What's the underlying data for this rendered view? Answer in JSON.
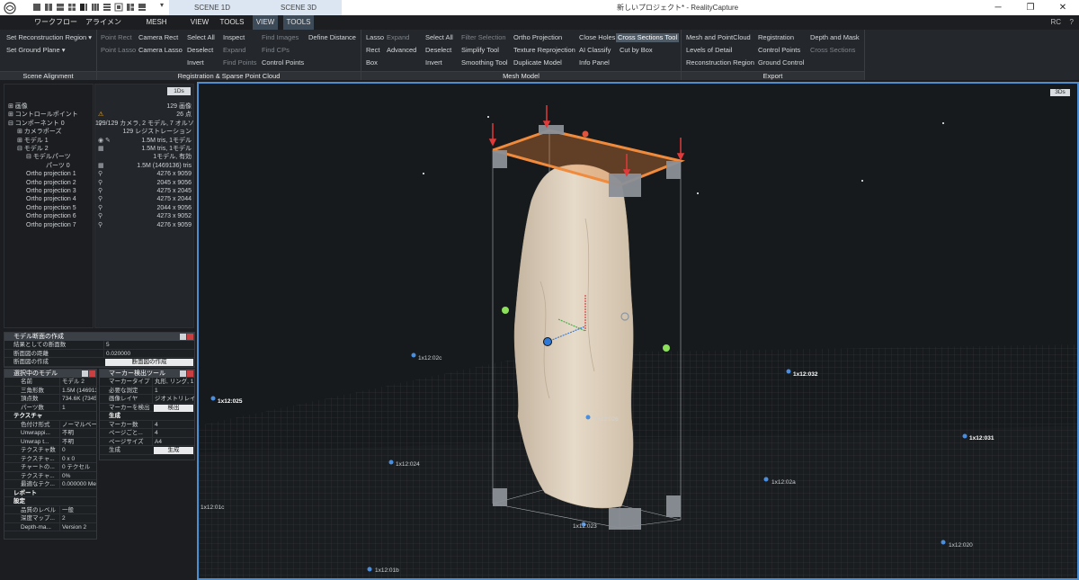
{
  "titlebar": {
    "scenes": [
      "SCENE 1D",
      "SCENE 3D"
    ],
    "window_title": "新しいプロジェクト* - RealityCapture",
    "controls": [
      "─",
      "❐",
      "✕"
    ]
  },
  "menubar": {
    "items": [
      "ワークフロー",
      "アライメント",
      "MESH MODEL",
      "VIEW",
      "TOOLS",
      "VIEW",
      "TOOLS"
    ],
    "user": "RC",
    "help": "?"
  },
  "ribbon": {
    "scene_alignment": {
      "label": "Scene Alignment",
      "buttons": [
        "Set Reconstruction Region ▾",
        "Set Ground Plane ▾"
      ]
    },
    "registration": {
      "label": "Registration & Sparse Point Cloud",
      "buttons": [
        "Point Rect",
        "Camera Rect",
        "Select All",
        "Inspect",
        "Find Images",
        "Define Distance",
        "Point Lasso",
        "Camera Lasso",
        "Deselect",
        "Expand",
        "Find CPs",
        "Invert",
        "Find Points",
        "Control Points"
      ]
    },
    "mesh_model": {
      "label": "Mesh Model",
      "buttons": [
        "Lasso",
        "Expand",
        "Select All",
        "Filter Selection",
        "Ortho Projection",
        "Close Holes",
        "Cross Sections Tool",
        "Rect",
        "Advanced",
        "Deselect",
        "Simplify Tool",
        "Texture Reprojection",
        "AI Classify",
        "Cut by Box",
        "Box",
        "Invert",
        "Smoothing Tool",
        "Duplicate Model",
        "Info Panel"
      ]
    },
    "export": {
      "label": "Export",
      "buttons": [
        "Mesh and PointCloud",
        "Registration",
        "Depth and Mask",
        "Levels of Detail",
        "Control Points",
        "Cross Sections",
        "Reconstruction Region",
        "Ground Control"
      ]
    }
  },
  "tree": {
    "tab": "1Ds",
    "items": [
      {
        "label": "⊞ 画像",
        "info": "129 画像",
        "icon": ""
      },
      {
        "label": "⊞ コントロールポイント",
        "info": "26 点",
        "icon": "⚠"
      },
      {
        "label": "⊟ コンポーネント 0",
        "info": "129/129 カメラ, 2 モデル, 7 オルソ",
        "icon": "⚲"
      },
      {
        "label": "⊞ カメラポーズ",
        "info": "129 レジストレーション",
        "icon": ""
      },
      {
        "label": "⊞ モデル 1",
        "info": "1.5M tris, 1モデル",
        "icon": "◉ ✎"
      },
      {
        "label": "⊟ モデル 2",
        "info": "1.5M tris, 1モデル",
        "icon": "▦"
      },
      {
        "label": "⊟ モデルパーツ",
        "info": "1モデル, 有効",
        "icon": ""
      },
      {
        "label": "パーツ 0",
        "info": "1.5M (1469136) tris",
        "icon": "▦"
      },
      {
        "label": "Ortho projection 1",
        "info": "4276 x 9059",
        "icon": "⚲"
      },
      {
        "label": "Ortho projection 2",
        "info": "2045 x 9056",
        "icon": "⚲"
      },
      {
        "label": "Ortho projection 3",
        "info": "4275 x 2045",
        "icon": "⚲"
      },
      {
        "label": "Ortho projection 4",
        "info": "4275 x 2044",
        "icon": "⚲"
      },
      {
        "label": "Ortho projection 5",
        "info": "2044 x 9056",
        "icon": "⚲"
      },
      {
        "label": "Ortho projection 6",
        "info": "4273 x 9052",
        "icon": "⚲"
      },
      {
        "label": "Ortho projection 7",
        "info": "4276 x 9059",
        "icon": "⚲"
      }
    ]
  },
  "cross_section_panel": {
    "title": "モデル断面の作成",
    "rows": [
      {
        "k": "結果としての断面数",
        "v": "5"
      },
      {
        "k": "断面図の距離",
        "v": "0.020000"
      },
      {
        "k": "断面図の作成",
        "v": ""
      }
    ],
    "button": "断面図の作成"
  },
  "selected_model_panel": {
    "title": "選択中のモデル",
    "rows": [
      {
        "k": "名前",
        "v": "モデル 2"
      },
      {
        "k": "三角形数",
        "v": "1.5M (1469136)"
      },
      {
        "k": "頂点数",
        "v": "734.6K (734570)"
      },
      {
        "k": "パーツ数",
        "v": "1"
      },
      {
        "k": "テクスチャ",
        "v": "",
        "sec": true
      },
      {
        "k": "色付け形式",
        "v": "ノーマルベース"
      },
      {
        "k": "Unwrappi...",
        "v": "不明"
      },
      {
        "k": "Unwrap t...",
        "v": "不明"
      },
      {
        "k": "テクスチャ数",
        "v": "0"
      },
      {
        "k": "テクスチャ...",
        "v": "0 x 0"
      },
      {
        "k": "チャートの...",
        "v": "0 テクセル"
      },
      {
        "k": "テクスチャ...",
        "v": "0%"
      },
      {
        "k": "最適なテク...",
        "v": "0.000000 Met..."
      },
      {
        "k": "レポート",
        "v": "",
        "sec": true
      },
      {
        "k": "設定",
        "v": "",
        "sec": true
      },
      {
        "k": "品質のレベル",
        "v": "一般"
      },
      {
        "k": "深度マップ...",
        "v": "2"
      },
      {
        "k": "Depth-ma...",
        "v": "Version 2"
      }
    ]
  },
  "marker_panel": {
    "title": "マーカー検出ツール",
    "rows": [
      {
        "k": "マーカータイプ",
        "v": "丸形, リング, 1..."
      },
      {
        "k": "必要な測定",
        "v": "1"
      },
      {
        "k": "画像レイヤ",
        "v": "ジオメトリレイヤー"
      },
      {
        "k": "マーカーを検出",
        "v": ""
      },
      {
        "k": "生成",
        "v": "",
        "sec": true
      },
      {
        "k": "マーカー数",
        "v": "4"
      },
      {
        "k": "ページごと...",
        "v": "4"
      },
      {
        "k": "ページサイズ",
        "v": "A4"
      },
      {
        "k": "生成",
        "v": ""
      }
    ],
    "detect_button": "検出",
    "generate_button": "生成"
  },
  "viewport": {
    "tab": "3Ds",
    "markers": [
      "1x12:02c",
      "1x12:032",
      "1x12:025",
      "1x12:031",
      "1x12:024",
      "1x12:026",
      "1x12:02a",
      "1x12:01c",
      "1x12:020",
      "1x12:023",
      "1x12:01b"
    ]
  }
}
